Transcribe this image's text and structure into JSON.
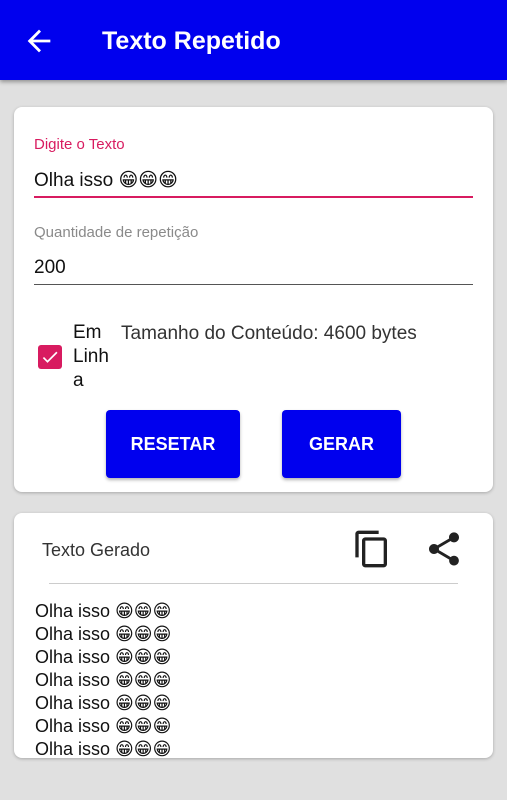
{
  "appbar": {
    "title": "Texto Repetido",
    "back_icon": "arrow-left-icon",
    "color": "#0000ee"
  },
  "form": {
    "text_label": "Digite o Texto",
    "text_value": "Olha isso 😁😁😁",
    "qty_label": "Quantidade de repetição",
    "qty_value": "200",
    "inline_checked": true,
    "inline_label": [
      "Em",
      "Linh",
      "a"
    ],
    "size_info": "Tamanho do Conteúdo: 4600 bytes",
    "reset_label": "RESETAR",
    "generate_label": "GERAR",
    "accent_color": "#d81b60"
  },
  "result": {
    "title": "Texto Gerado",
    "copy_icon": "copy-icon",
    "share_icon": "share-icon",
    "lines": [
      "Olha isso 😁😁😁",
      "Olha isso 😁😁😁",
      "Olha isso 😁😁😁",
      "Olha isso 😁😁😁",
      "Olha isso 😁😁😁",
      "Olha isso 😁😁😁",
      "Olha isso 😁😁😁"
    ]
  }
}
